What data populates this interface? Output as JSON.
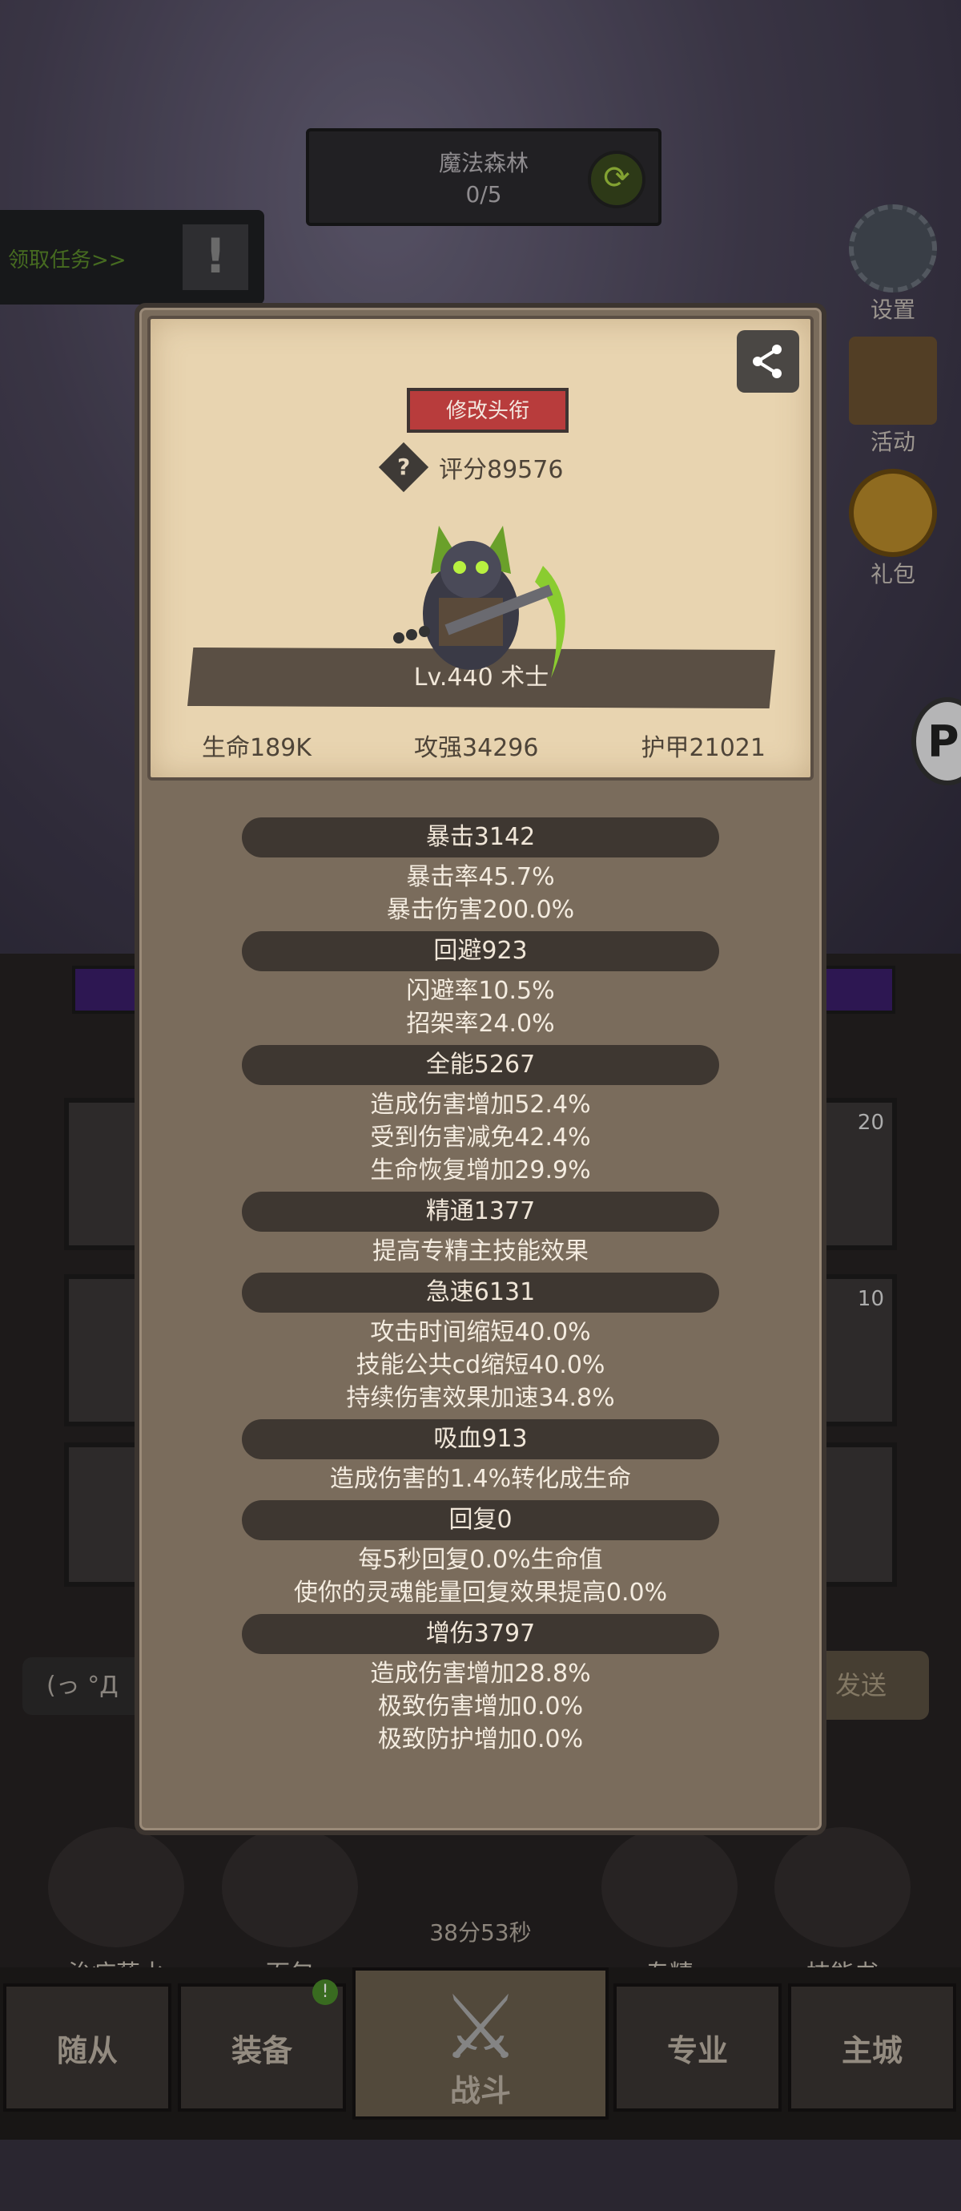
{
  "stage": {
    "name": "魔法森林",
    "progress": "0/5"
  },
  "quest": {
    "label": "领取任务>>"
  },
  "side_menu": {
    "settings": "设置",
    "activity": "活动",
    "gift": "礼包"
  },
  "slot_badges": [
    "20",
    "10"
  ],
  "chat": {
    "input_text": "(っ °Д",
    "send_label": "发送"
  },
  "consumables": {
    "potion": "治疗药水",
    "bread": "面包",
    "specialty": "专精",
    "skill_book": "技能书",
    "timer": "38分53秒"
  },
  "bottom_nav": {
    "followers": "随从",
    "equipment": "装备",
    "battle": "战斗",
    "profession": "专业",
    "main_city": "主城",
    "new_badge": "!"
  },
  "panel": {
    "change_title_label": "修改头衔",
    "score": "评分89576",
    "level_text": "Lv.440 术士",
    "base_stats": {
      "hp": "生命189K",
      "attack": "攻强34296",
      "armor": "护甲21021"
    },
    "stats": {
      "crit": {
        "header": "暴击3142",
        "lines": [
          "暴击率45.7%",
          "暴击伤害200.0%"
        ]
      },
      "dodge": {
        "header": "回避923",
        "lines": [
          "闪避率10.5%",
          "招架率24.0%"
        ]
      },
      "versatility": {
        "header": "全能5267",
        "lines": [
          "造成伤害增加52.4%",
          "受到伤害减免42.4%",
          "生命恢复增加29.9%"
        ]
      },
      "mastery": {
        "header": "精通1377",
        "lines": [
          "提高专精主技能效果"
        ]
      },
      "haste": {
        "header": "急速6131",
        "lines": [
          "攻击时间缩短40.0%",
          "技能公共cd缩短40.0%",
          "持续伤害效果加速34.8%"
        ]
      },
      "leech": {
        "header": "吸血913",
        "lines": [
          "造成伤害的1.4%转化成生命"
        ]
      },
      "regen": {
        "header": "回复0",
        "lines": [
          "每5秒回复0.0%生命值",
          "使你的灵魂能量回复效果提高0.0%"
        ]
      },
      "damage_up": {
        "header": "增伤3797",
        "lines": [
          "造成伤害增加28.8%",
          "极致伤害增加0.0%",
          "极致防护增加0.0%"
        ]
      }
    }
  }
}
